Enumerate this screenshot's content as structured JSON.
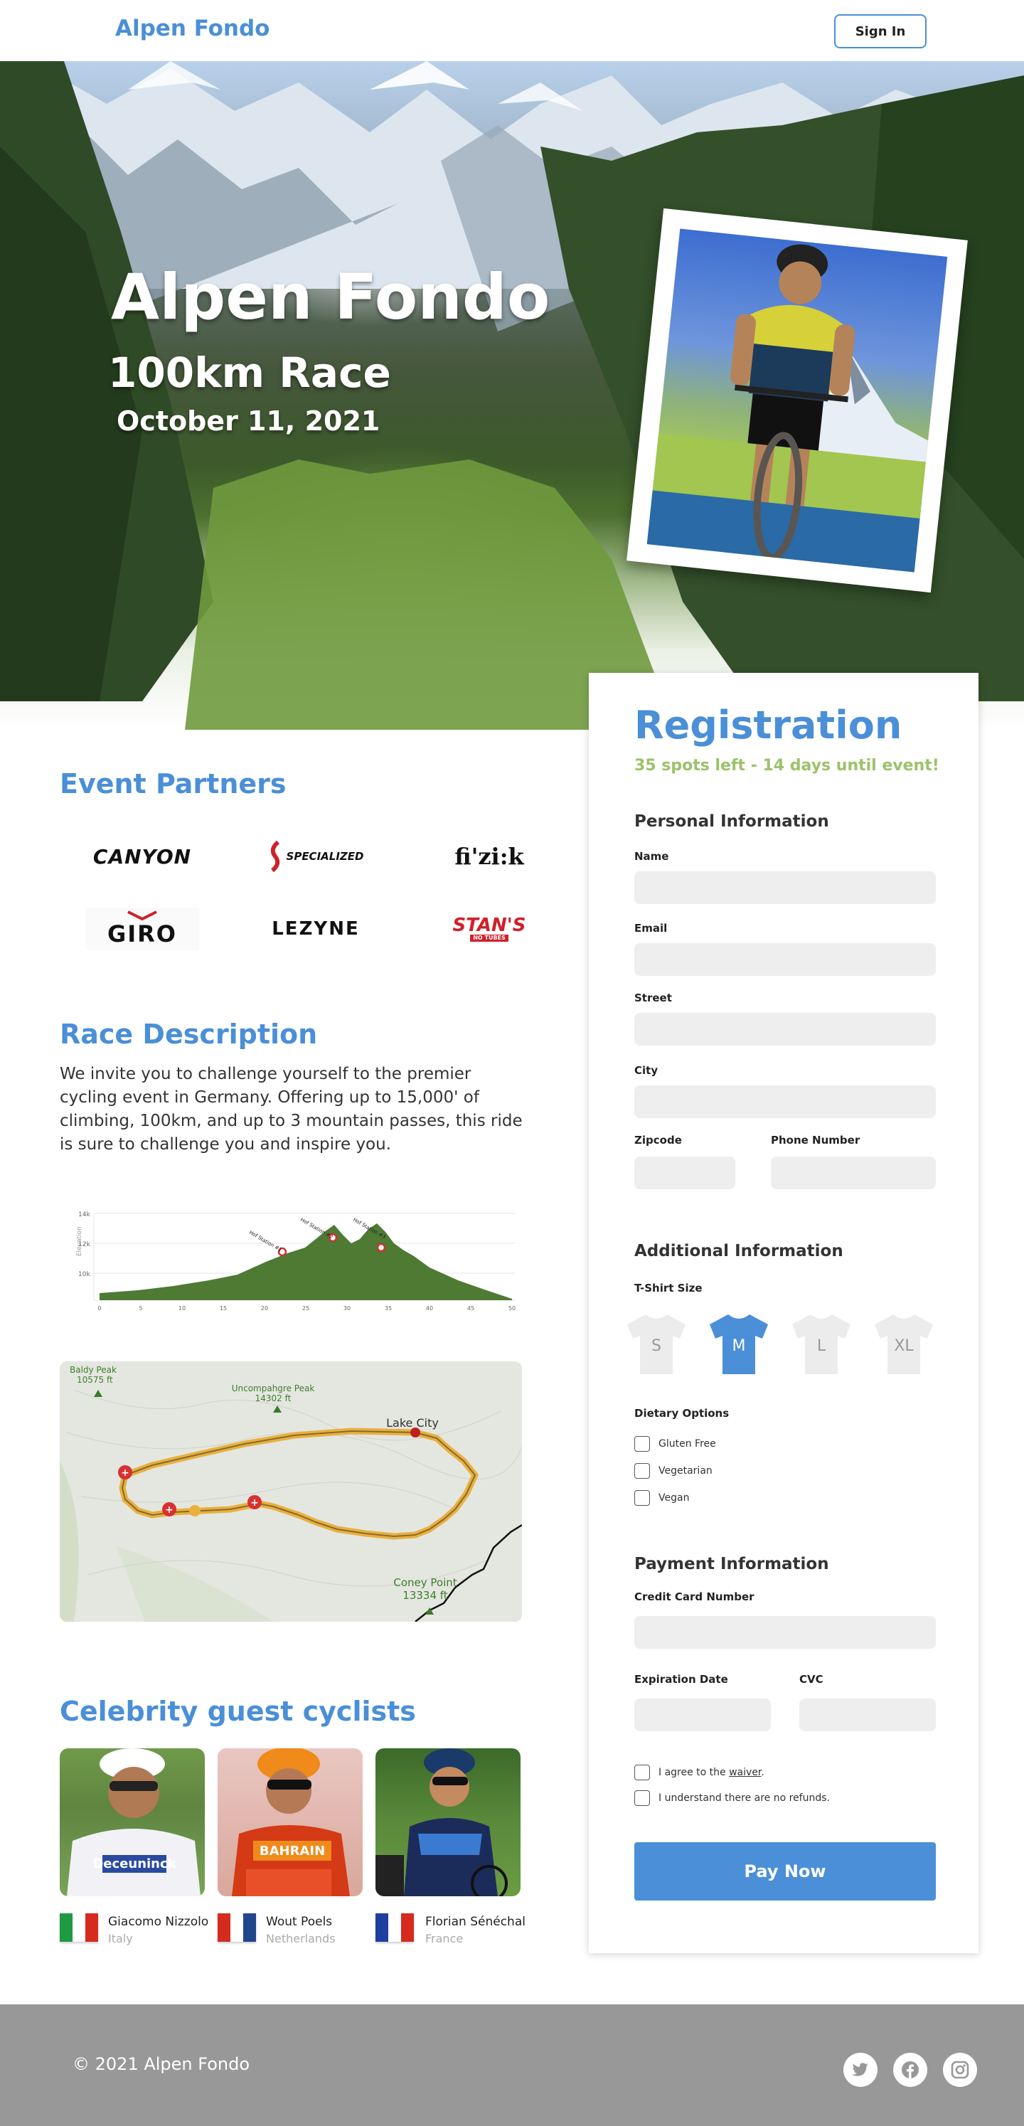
{
  "header": {
    "logo": "Alpen Fondo",
    "signin_label": "Sign In"
  },
  "hero": {
    "title": "Alpen Fondo",
    "subtitle": "100km Race",
    "date": "October 11, 2021"
  },
  "partners": {
    "heading": "Event Partners",
    "logos": [
      "CANYON",
      "SPECIALIZED",
      "fi'zi:k",
      "GIRO",
      "LEZYNE",
      "STAN'S",
      "NO TUBES"
    ]
  },
  "race": {
    "heading": "Race Description",
    "description": "We invite you to challenge yourself to the premier cycling event in Germany. Offering up to 15,000' of climbing, 100km, and up to 3 mountain passes, this ride is sure to challenge you and inspire you."
  },
  "elevation": {
    "ylabel": "Elevation",
    "yticks": [
      "14k",
      "12k",
      "10k"
    ],
    "xticks": [
      "0",
      "5",
      "10",
      "15",
      "20",
      "25",
      "30",
      "35",
      "40",
      "45",
      "50"
    ],
    "pass_labels": [
      "Hof Station #1",
      "Hof Station #2",
      "Hof Station #3"
    ]
  },
  "map": {
    "peaks": [
      {
        "name": "Baldy Peak",
        "elev": "10575 ft"
      },
      {
        "name": "Uncompahgre Peak",
        "elev": "14302 ft"
      },
      {
        "name": "Coney Point",
        "elev": "13334 ft"
      }
    ],
    "city": "Lake City"
  },
  "celebrities": {
    "heading": "Celebrity guest cyclists",
    "people": [
      {
        "name": "Giacomo Nizzolo",
        "country": "Italy",
        "jersey": "Deceuninck"
      },
      {
        "name": "Wout Poels",
        "country": "Netherlands",
        "jersey": "BAHRAIN"
      },
      {
        "name": "Florian Sénéchal",
        "country": "France",
        "jersey": ""
      }
    ]
  },
  "registration": {
    "title": "Registration",
    "subtitle": "35 spots left - 14 days until event!",
    "personal": {
      "heading": "Personal Information",
      "name": "Name",
      "email": "Email",
      "street": "Street",
      "city": "City",
      "zipcode": "Zipcode",
      "phone": "Phone Number"
    },
    "additional": {
      "heading": "Additional Information",
      "tshirt_label": "T-Shirt Size",
      "sizes": [
        "S",
        "M",
        "L",
        "XL"
      ],
      "selected_size": "M",
      "dietary_label": "Dietary Options",
      "dietary": [
        "Gluten Free",
        "Vegetarian",
        "Vegan"
      ]
    },
    "payment": {
      "heading": "Payment Information",
      "card": "Credit Card Number",
      "expiration": "Expiration Date",
      "cvc": "CVC",
      "agree_prefix": "I agree to the ",
      "agree_link": "waiver",
      "agree_suffix": ".",
      "refund": "I understand there are no refunds.",
      "pay_label": "Pay Now"
    }
  },
  "footer": {
    "copyright": "© 2021 Alpen Fondo",
    "social": [
      "twitter-icon",
      "facebook-icon",
      "instagram-icon"
    ]
  },
  "colors": {
    "accent": "#4a8fd7",
    "highlight": "#9bc26a",
    "footer": "#989898"
  }
}
